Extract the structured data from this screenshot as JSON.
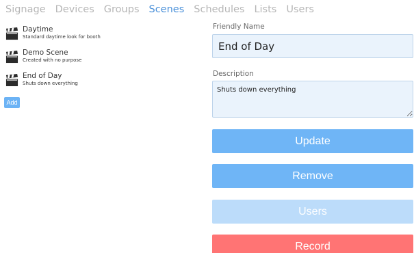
{
  "nav": {
    "tabs": [
      {
        "label": "Signage"
      },
      {
        "label": "Devices"
      },
      {
        "label": "Groups"
      },
      {
        "label": "Scenes"
      },
      {
        "label": "Schedules"
      },
      {
        "label": "Lists"
      },
      {
        "label": "Users"
      }
    ],
    "active_tab": "Scenes"
  },
  "scenes": [
    {
      "name": "Daytime",
      "description": "Standard daytime look for booth"
    },
    {
      "name": "Demo Scene",
      "description": "Created with no purpose"
    },
    {
      "name": "End of Day",
      "description": "Shuts down everything"
    }
  ],
  "add_label": "Add",
  "form": {
    "friendly_name_label": "Friendly Name",
    "friendly_name_value": "End of Day",
    "description_label": "Description",
    "description_value": "Shuts down everything"
  },
  "buttons": {
    "update": "Update",
    "remove": "Remove",
    "users": "Users",
    "record": "Record"
  },
  "colors": {
    "active_tab": "#4a90d9",
    "primary_button": "#6fb5f6",
    "disabled_button": "#bcdcfa",
    "record_button": "#ff7474",
    "input_bg": "#eaf3fc"
  },
  "icons": {
    "scene_icon": "clapperboard-icon"
  }
}
